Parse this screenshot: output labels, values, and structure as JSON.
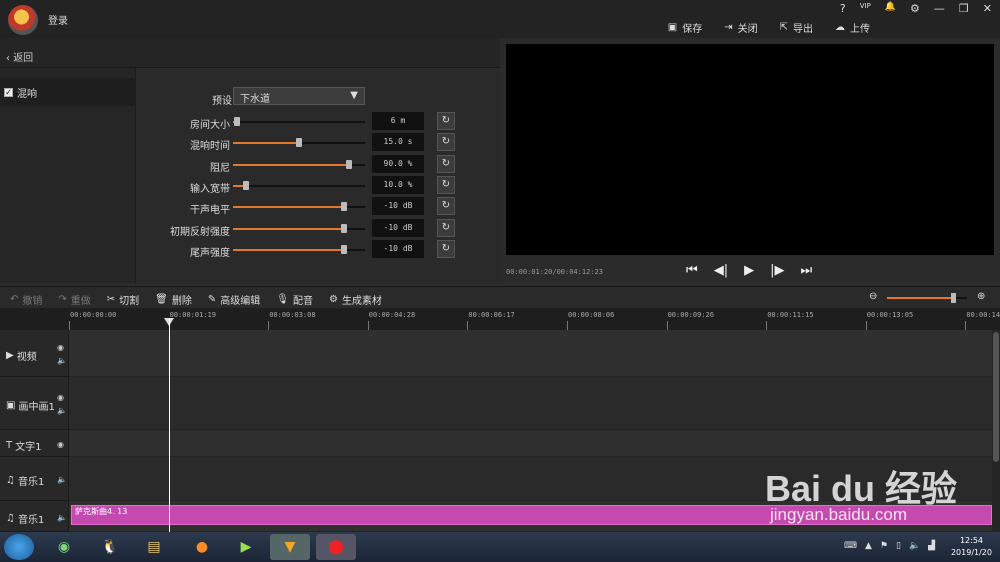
{
  "header": {
    "login": "登录",
    "win_help": "?",
    "win_vip": "VIP",
    "win_bell": "🔔",
    "win_gear": "⚙",
    "win_min": "—",
    "win_max": "❐",
    "win_close": "✕"
  },
  "toolbar": {
    "save": "保存",
    "close": "关闭",
    "export": "导出",
    "upload": "上传"
  },
  "panel": {
    "back": "返回",
    "effect_item": "混响",
    "delete_btn": "删除",
    "clear_btn": "清空",
    "preset_label": "预设",
    "preset_value": "下水道"
  },
  "params": [
    {
      "label": "房间大小",
      "value": "6 m",
      "level": 0.03
    },
    {
      "label": "混响时间",
      "value": "15.0 s",
      "level": 0.5
    },
    {
      "label": "阻尼",
      "value": "90.0 %",
      "level": 0.88
    },
    {
      "label": "输入宽带",
      "value": "10.0 %",
      "level": 0.1
    },
    {
      "label": "干声电平",
      "value": "-10 dB",
      "level": 0.84
    },
    {
      "label": "初期反射强度",
      "value": "-10 dB",
      "level": 0.84
    },
    {
      "label": "尾声强度",
      "value": "-10 dB",
      "level": 0.84
    }
  ],
  "preview": {
    "timecode": "00:00:01:20/00:04:12:23"
  },
  "timeline": {
    "tools": [
      "撤销",
      "重做",
      "切割",
      "删除",
      "高级编辑",
      "配音",
      "生成素材"
    ],
    "zoom": 0.82,
    "ruler": [
      "00:00:00:00",
      "00:00:01:19",
      "00:00:03:08",
      "00:00:04:28",
      "00:00:06:17",
      "00:00:08:06",
      "00:00:09:26",
      "00:00:11:15",
      "00:00:13:05",
      "00:00:14:"
    ],
    "tracks": [
      "视频",
      "画中画1",
      "文字1",
      "音乐1",
      "音乐1"
    ],
    "clip_label": "萨克斯曲4. 13"
  },
  "taskbar": {
    "time": "12:54",
    "date": "2019/1/20"
  },
  "watermark": {
    "brand": "Bai du 经验",
    "url": "jingyan.baidu.com"
  }
}
